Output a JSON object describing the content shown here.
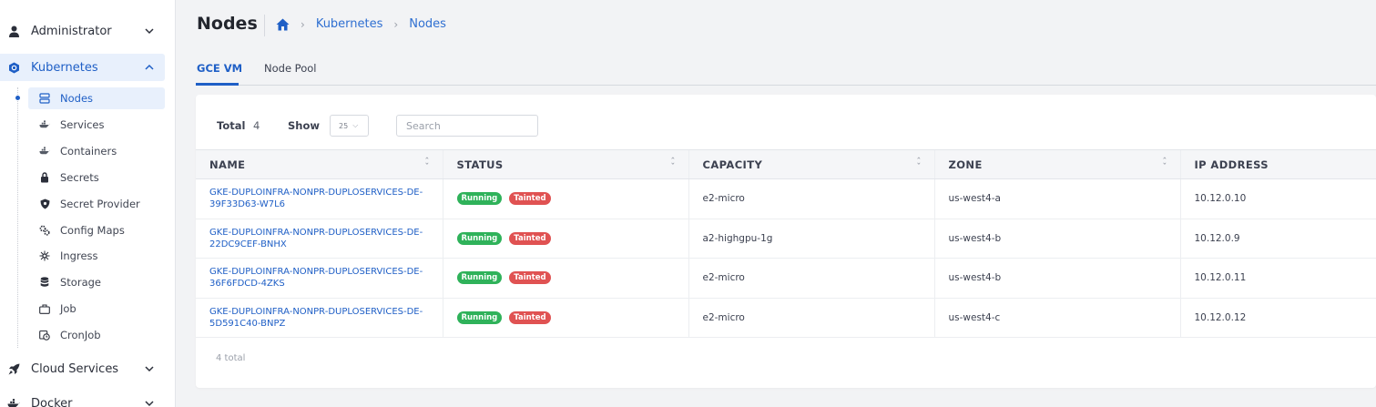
{
  "colors": {
    "accent": "#1f5fc6",
    "running": "#2fb25a",
    "tainted": "#e05252"
  },
  "sidebar": {
    "groups": [
      {
        "label": "Administrator",
        "icon": "user-icon"
      },
      {
        "label": "Kubernetes",
        "icon": "kubernetes-icon"
      },
      {
        "label": "Cloud Services",
        "icon": "rocket-icon"
      },
      {
        "label": "Docker",
        "icon": "docker-icon"
      }
    ],
    "sub_items": [
      {
        "label": "Nodes",
        "icon": "server-icon"
      },
      {
        "label": "Services",
        "icon": "docker-icon"
      },
      {
        "label": "Containers",
        "icon": "docker-icon"
      },
      {
        "label": "Secrets",
        "icon": "lock-icon"
      },
      {
        "label": "Secret Provider",
        "icon": "shield-icon"
      },
      {
        "label": "Config Maps",
        "icon": "gears-icon"
      },
      {
        "label": "Ingress",
        "icon": "network-icon"
      },
      {
        "label": "Storage",
        "icon": "database-icon"
      },
      {
        "label": "Job",
        "icon": "briefcase-icon"
      },
      {
        "label": "CronJob",
        "icon": "clock-icon"
      }
    ]
  },
  "header": {
    "title": "Nodes",
    "breadcrumb": [
      "Kubernetes",
      "Nodes"
    ]
  },
  "tabs": [
    "GCE VM",
    "Node Pool"
  ],
  "toolbar": {
    "total_label": "Total",
    "total_value": "4",
    "show_label": "Show",
    "show_value": "25",
    "search_placeholder": "Search"
  },
  "table": {
    "columns": [
      "NAME",
      "STATUS",
      "CAPACITY",
      "ZONE",
      "IP ADDRESS"
    ],
    "rows": [
      {
        "name": "GKE-DUPLOINFRA-NONPR-DUPLOSERVICES-DE-39F33D63-W7L6",
        "status": [
          "Running",
          "Tainted"
        ],
        "capacity": "e2-micro",
        "zone": "us-west4-a",
        "ip": "10.12.0.10"
      },
      {
        "name": "GKE-DUPLOINFRA-NONPR-DUPLOSERVICES-DE-22DC9CEF-BNHX",
        "status": [
          "Running",
          "Tainted"
        ],
        "capacity": "a2-highgpu-1g",
        "zone": "us-west4-b",
        "ip": "10.12.0.9"
      },
      {
        "name": "GKE-DUPLOINFRA-NONPR-DUPLOSERVICES-DE-36F6FDCD-4ZKS",
        "status": [
          "Running",
          "Tainted"
        ],
        "capacity": "e2-micro",
        "zone": "us-west4-b",
        "ip": "10.12.0.11"
      },
      {
        "name": "GKE-DUPLOINFRA-NONPR-DUPLOSERVICES-DE-5D591C40-BNPZ",
        "status": [
          "Running",
          "Tainted"
        ],
        "capacity": "e2-micro",
        "zone": "us-west4-c",
        "ip": "10.12.0.12"
      }
    ],
    "footer": "4 total"
  }
}
